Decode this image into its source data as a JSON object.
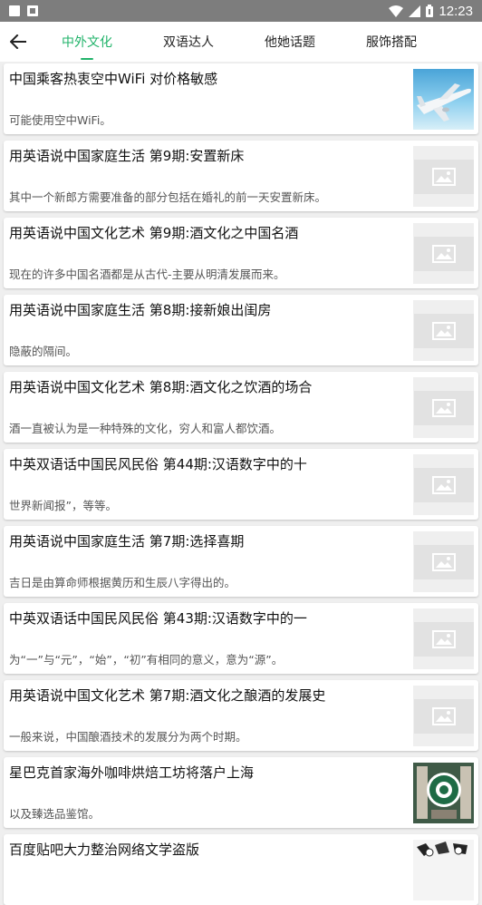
{
  "status_bar": {
    "time": "12:23"
  },
  "tabs": [
    {
      "label": "中外文化",
      "active": true
    },
    {
      "label": "双语达人",
      "active": false
    },
    {
      "label": "他她话题",
      "active": false
    },
    {
      "label": "服饰搭配",
      "active": false
    }
  ],
  "articles": [
    {
      "title": "中国乘客热衷空中WiFi 对价格敏感",
      "summary": "可能使用空中WiFi。",
      "thumbnail": "airplane-image"
    },
    {
      "title": "用英语说中国家庭生活 第9期:安置新床",
      "summary": "其中一个新郎方需要准备的部分包括在婚礼的前一天安置新床。",
      "thumbnail": "placeholder"
    },
    {
      "title": "用英语说中国文化艺术 第9期:酒文化之中国名酒",
      "summary": "现在的许多中国名酒都是从古代-主要从明清发展而来。",
      "thumbnail": "placeholder"
    },
    {
      "title": "用英语说中国家庭生活 第8期:接新娘出闺房",
      "summary": "隐蔽的隔间。",
      "thumbnail": "placeholder"
    },
    {
      "title": "用英语说中国文化艺术 第8期:酒文化之饮酒的场合",
      "summary": "酒一直被认为是一种特殊的文化，穷人和富人都饮酒。",
      "thumbnail": "placeholder"
    },
    {
      "title": "中英双语话中国民风民俗 第44期:汉语数字中的十",
      "summary": "世界新闻报”，等等。",
      "thumbnail": "placeholder"
    },
    {
      "title": "用英语说中国家庭生活 第7期:选择喜期",
      "summary": "吉日是由算命师根据黄历和生辰八字得出的。",
      "thumbnail": "placeholder"
    },
    {
      "title": "中英双语话中国民风民俗 第43期:汉语数字中的一",
      "summary": "为“一”与“元”，“始”，“初”有相同的意义，意为“源”。",
      "thumbnail": "placeholder"
    },
    {
      "title": "用英语说中国文化艺术 第7期:酒文化之酿酒的发展史",
      "summary": "一般来说，中国酿酒技术的发展分为两个时期。",
      "thumbnail": "placeholder"
    },
    {
      "title": "星巴克首家海外咖啡烘焙工坊将落户上海",
      "summary": "以及臻选品鉴馆。",
      "thumbnail": "starbucks-image"
    },
    {
      "title": "百度贴吧大力整治网络文学盗版",
      "summary": "",
      "thumbnail": "comic-image"
    }
  ]
}
